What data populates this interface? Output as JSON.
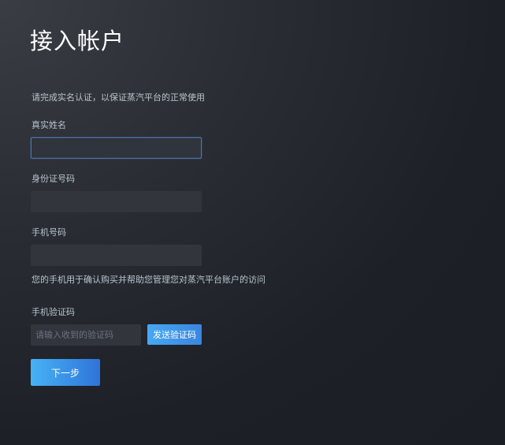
{
  "page": {
    "title": "接入帐户",
    "intro": "请完成实名认证，以保证蒸汽平台的正常使用"
  },
  "form": {
    "real_name": {
      "label": "真实姓名",
      "value": "",
      "focused": true
    },
    "id_number": {
      "label": "身份证号码",
      "value": ""
    },
    "phone": {
      "label": "手机号码",
      "value": "",
      "note": "您的手机用于确认购买并帮助您管理您对蒸汽平台账户的访问"
    },
    "verification_code": {
      "label": "手机验证码",
      "value": "",
      "placeholder": "请输入收到的验证码",
      "send_button_label": "发送验证码"
    },
    "next_button_label": "下一步"
  },
  "colors": {
    "accent_blue_start": "#47b2f6",
    "accent_blue_end": "#2f74d8",
    "focus_border": "#4a76ad",
    "input_bg": "#32353c",
    "text_muted": "#b8c3cc",
    "title": "#ffffff"
  }
}
